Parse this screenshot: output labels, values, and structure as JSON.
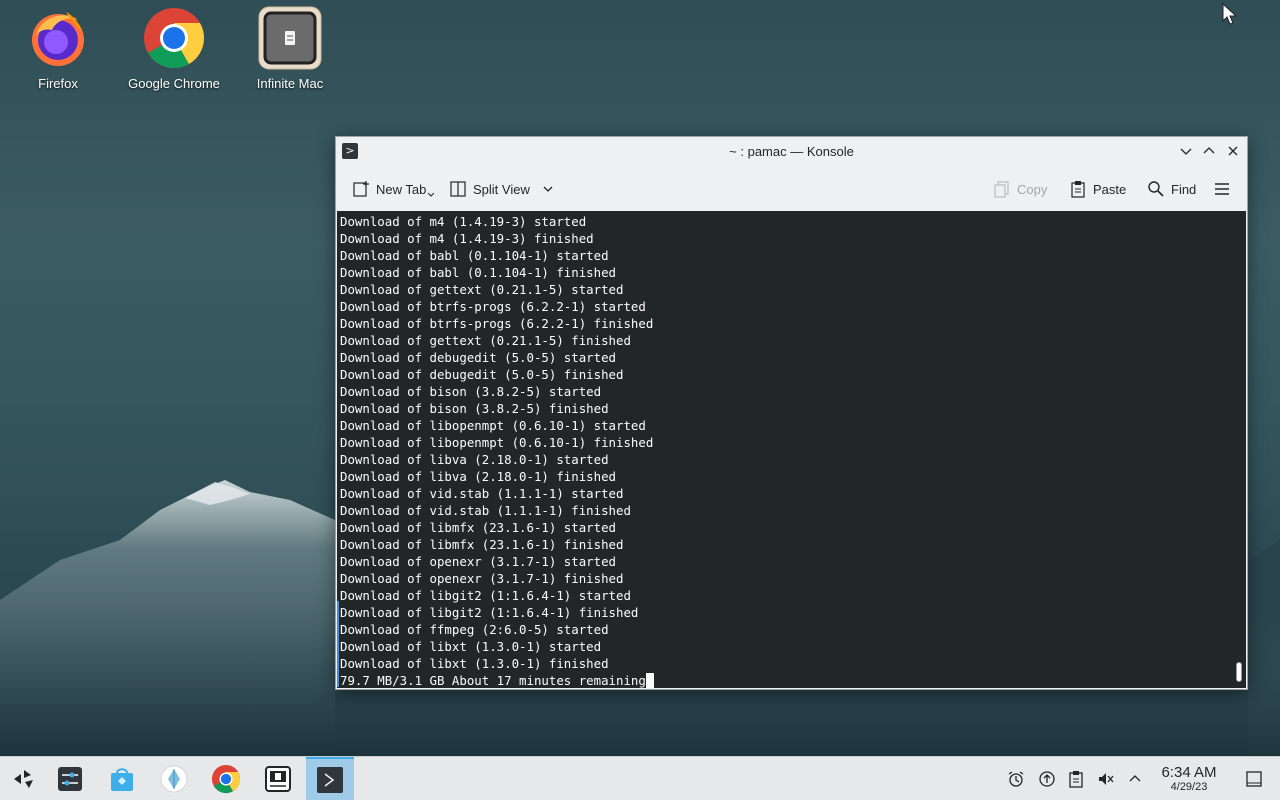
{
  "desktop": {
    "icons": [
      {
        "label": "Firefox"
      },
      {
        "label": "Google Chrome"
      },
      {
        "label": "Infinite Mac"
      }
    ]
  },
  "window": {
    "title": "~ : pamac — Konsole",
    "toolbar": {
      "new_tab": "New Tab",
      "split_view": "Split View",
      "copy": "Copy",
      "paste": "Paste",
      "find": "Find"
    },
    "terminal_lines": [
      "Download of m4 (1.4.19-3) started",
      "Download of m4 (1.4.19-3) finished",
      "Download of babl (0.1.104-1) started",
      "Download of babl (0.1.104-1) finished",
      "Download of gettext (0.21.1-5) started",
      "Download of btrfs-progs (6.2.2-1) started",
      "Download of btrfs-progs (6.2.2-1) finished",
      "Download of gettext (0.21.1-5) finished",
      "Download of debugedit (5.0-5) started",
      "Download of debugedit (5.0-5) finished",
      "Download of bison (3.8.2-5) started",
      "Download of bison (3.8.2-5) finished",
      "Download of libopenmpt (0.6.10-1) started",
      "Download of libopenmpt (0.6.10-1) finished",
      "Download of libva (2.18.0-1) started",
      "Download of libva (2.18.0-1) finished",
      "Download of vid.stab (1.1.1-1) started",
      "Download of vid.stab (1.1.1-1) finished",
      "Download of libmfx (23.1.6-1) started",
      "Download of libmfx (23.1.6-1) finished",
      "Download of openexr (3.1.7-1) started",
      "Download of openexr (3.1.7-1) finished",
      "Download of libgit2 (1:1.6.4-1) started",
      "Download of libgit2 (1:1.6.4-1) finished",
      "Download of ffmpeg (2:6.0-5) started",
      "Download of libxt (1.3.0-1) started",
      "Download of libxt (1.3.0-1) finished"
    ],
    "status_line": "79.7 MB/3.1 GB About 17 minutes remaining"
  },
  "taskbar": {
    "clock_time": "6:34 AM",
    "clock_date": "4/29/23"
  },
  "colors": {
    "terminal_bg": "#232627",
    "terminal_fg": "#fcfcfc",
    "accent": "#3daee9"
  }
}
